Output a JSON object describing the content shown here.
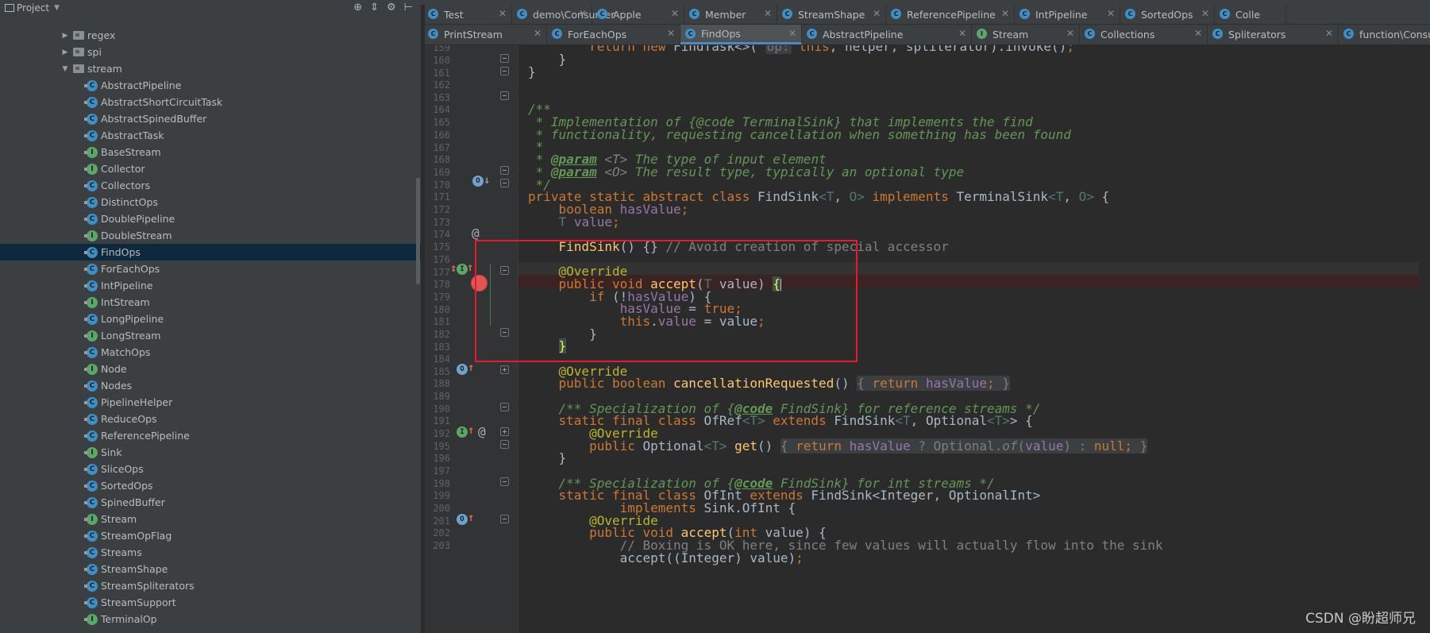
{
  "project_panel": {
    "title": "Project",
    "tree": [
      {
        "label": "regex",
        "kind": "package",
        "arrow": "▶"
      },
      {
        "label": "spi",
        "kind": "package",
        "arrow": "▶"
      },
      {
        "label": "stream",
        "kind": "package",
        "arrow": "▼"
      },
      {
        "label": "AbstractPipeline",
        "kind": "class"
      },
      {
        "label": "AbstractShortCircuitTask",
        "kind": "class"
      },
      {
        "label": "AbstractSpinedBuffer",
        "kind": "class"
      },
      {
        "label": "AbstractTask",
        "kind": "class"
      },
      {
        "label": "BaseStream",
        "kind": "interface"
      },
      {
        "label": "Collector",
        "kind": "interface"
      },
      {
        "label": "Collectors",
        "kind": "class"
      },
      {
        "label": "DistinctOps",
        "kind": "class"
      },
      {
        "label": "DoublePipeline",
        "kind": "class"
      },
      {
        "label": "DoubleStream",
        "kind": "interface"
      },
      {
        "label": "FindOps",
        "kind": "class",
        "selected": true
      },
      {
        "label": "ForEachOps",
        "kind": "class"
      },
      {
        "label": "IntPipeline",
        "kind": "class"
      },
      {
        "label": "IntStream",
        "kind": "interface"
      },
      {
        "label": "LongPipeline",
        "kind": "class"
      },
      {
        "label": "LongStream",
        "kind": "interface"
      },
      {
        "label": "MatchOps",
        "kind": "class"
      },
      {
        "label": "Node",
        "kind": "interface"
      },
      {
        "label": "Nodes",
        "kind": "class"
      },
      {
        "label": "PipelineHelper",
        "kind": "class"
      },
      {
        "label": "ReduceOps",
        "kind": "class"
      },
      {
        "label": "ReferencePipeline",
        "kind": "class"
      },
      {
        "label": "Sink",
        "kind": "interface"
      },
      {
        "label": "SliceOps",
        "kind": "class"
      },
      {
        "label": "SortedOps",
        "kind": "class"
      },
      {
        "label": "SpinedBuffer",
        "kind": "class"
      },
      {
        "label": "Stream",
        "kind": "interface"
      },
      {
        "label": "StreamOpFlag",
        "kind": "class"
      },
      {
        "label": "Streams",
        "kind": "class"
      },
      {
        "label": "StreamShape",
        "kind": "class"
      },
      {
        "label": "StreamSpliterators",
        "kind": "class"
      },
      {
        "label": "StreamSupport",
        "kind": "class"
      },
      {
        "label": "TerminalOp",
        "kind": "interface"
      }
    ]
  },
  "tabs_row1": [
    {
      "label": "Test",
      "icon": "c"
    },
    {
      "label": "demo\\Consumer",
      "icon": "c"
    },
    {
      "label": "Apple",
      "icon": "c"
    },
    {
      "label": "Member",
      "icon": "c"
    },
    {
      "label": "StreamShape",
      "icon": "c"
    },
    {
      "label": "ReferencePipeline",
      "icon": "c"
    },
    {
      "label": "IntPipeline",
      "icon": "c"
    },
    {
      "label": "SortedOps",
      "icon": "c"
    },
    {
      "label": "Colle",
      "icon": "c"
    }
  ],
  "tabs_row2": [
    {
      "label": "PrintStream",
      "icon": "c"
    },
    {
      "label": "ForEachOps",
      "icon": "c"
    },
    {
      "label": "FindOps",
      "icon": "c",
      "active": true
    },
    {
      "label": "AbstractPipeline",
      "icon": "c"
    },
    {
      "label": "Stream",
      "icon": "i"
    },
    {
      "label": "Collections",
      "icon": "c"
    },
    {
      "label": "Spliterators",
      "icon": "c"
    },
    {
      "label": "function\\Consu",
      "icon": "c"
    }
  ],
  "editor": {
    "line_numbers": [
      "159",
      "160",
      "161",
      "162",
      "163",
      "164",
      "165",
      "166",
      "167",
      "168",
      "169",
      "170",
      "171",
      "172",
      "173",
      "174",
      "175",
      "176",
      "177",
      "178",
      "179",
      "180",
      "181",
      "182",
      "183",
      "184",
      "185",
      "188",
      "189",
      "190",
      "191",
      "192",
      "195",
      "196",
      "197",
      "198",
      "199",
      "200",
      "201",
      "202",
      "203"
    ]
  },
  "watermark": "CSDN @盼超师兄"
}
